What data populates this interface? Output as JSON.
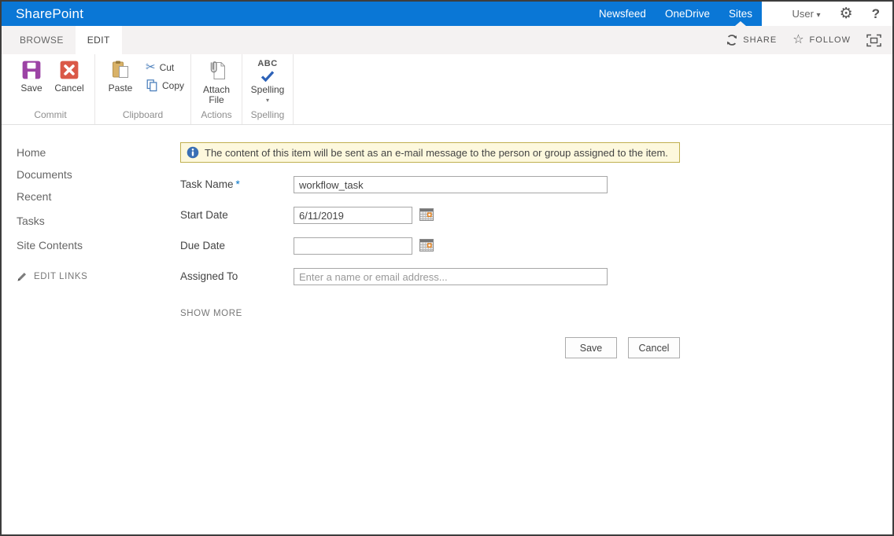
{
  "suite_bar": {
    "brand": "SharePoint",
    "nav": [
      {
        "label": "Newsfeed"
      },
      {
        "label": "OneDrive"
      },
      {
        "label": "Sites"
      }
    ],
    "user_label": "User",
    "user_caret": "▾",
    "gear_glyph": "⚙",
    "help_label": "?"
  },
  "tab_bar": {
    "tabs": [
      {
        "label": "BROWSE"
      },
      {
        "label": "EDIT"
      }
    ],
    "share_label": "SHARE",
    "follow_label": "FOLLOW",
    "follow_star_glyph": "☆"
  },
  "ribbon": {
    "commit": {
      "group_label": "Commit",
      "save": "Save",
      "cancel": "Cancel"
    },
    "clipboard": {
      "group_label": "Clipboard",
      "paste": "Paste",
      "cut": "Cut",
      "copy": "Copy",
      "scissors_glyph": "✂"
    },
    "actions": {
      "group_label": "Actions",
      "attach": "Attach File"
    },
    "spelling": {
      "group_label": "Spelling",
      "button": "Spelling",
      "abc": "ABC",
      "caret": "▾"
    }
  },
  "sidebar": {
    "items": [
      {
        "label": "Home"
      },
      {
        "label": "Documents"
      },
      {
        "label": "Recent"
      },
      {
        "label": "Tasks"
      },
      {
        "label": "Site Contents"
      }
    ],
    "edit_links": "EDIT LINKS"
  },
  "form": {
    "notice": "The content of this item will be sent as an e-mail message to the person or group assigned to the item.",
    "task_name": {
      "label": "Task Name",
      "required_mark": "*",
      "value": "workflow_task"
    },
    "start_date": {
      "label": "Start Date",
      "value": "6/11/2019"
    },
    "due_date": {
      "label": "Due Date",
      "value": ""
    },
    "assigned_to": {
      "label": "Assigned To",
      "placeholder": "Enter a name or email address..."
    },
    "show_more": "SHOW MORE",
    "buttons": {
      "save": "Save",
      "cancel": "Cancel"
    }
  },
  "icons": {
    "save": "floppy-disk",
    "cancel": "x-square",
    "paste": "clipboard-page",
    "cut": "scissors",
    "copy": "two-pages",
    "attach_file": "paperclip-page",
    "spelling": "abc-checkmark",
    "share": "sync-arrows",
    "follow": "star-outline",
    "focus": "focus-brackets",
    "settings": "gear",
    "help": "question-mark",
    "user_menu": "chevron-down",
    "date_picker": "calendar",
    "edit_links": "pencil",
    "notice": "info-circle"
  },
  "colors": {
    "suite_bar_blue": "#0a77d6",
    "tab_row_gray": "#f4f2f2",
    "banner_bg": "#fdf8dd",
    "banner_border": "#c0b050",
    "save_icon_purple": "#9c43a5",
    "cancel_icon_red": "#da5948",
    "paste_icon_tan": "#d9b268",
    "icon_blue": "#4a7ebb",
    "required_mark": "#0072c6",
    "link_gray": "#666666"
  }
}
